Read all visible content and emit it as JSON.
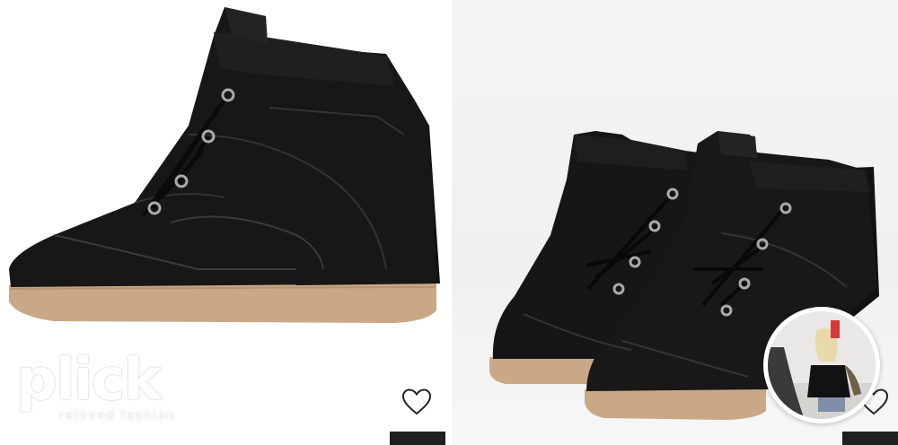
{
  "logo": {
    "wordmark": "plick",
    "tagline": "reloved fashion"
  },
  "listing": {
    "images": [
      {
        "subject": "black suede wedge sneaker, side view"
      },
      {
        "subject": "pair of black suede wedge sneakers, front view"
      }
    ],
    "favorite_icon": "heart-outline-icon",
    "seller_avatar_icon": "seller-avatar"
  },
  "colors": {
    "background": "#ffffff",
    "shoe": "#151515",
    "sole": "#c9a888",
    "corner_badge": "#1f1f1f"
  }
}
